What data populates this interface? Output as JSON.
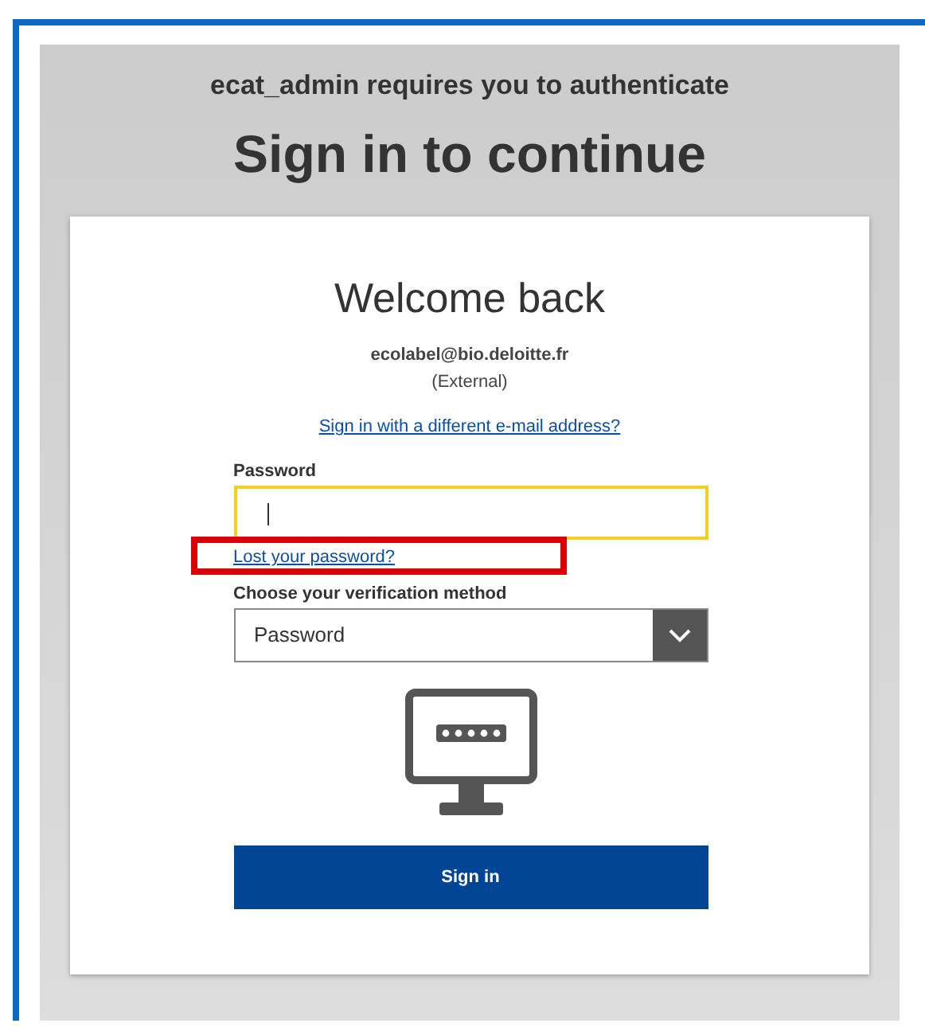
{
  "header": {
    "subtitle": "ecat_admin requires you to authenticate",
    "title": "Sign in to continue"
  },
  "card": {
    "heading": "Welcome back",
    "email": "ecolabel@bio.deloitte.fr",
    "account_type": "(External)",
    "switch_link": "Sign in with a different e-mail address?",
    "password": {
      "label": "Password",
      "focused": true
    },
    "lost_password": {
      "text": "Lost your password?",
      "highlighted": true
    },
    "method": {
      "label": "Choose your verification method",
      "value": "Password"
    },
    "submit": "Sign in"
  }
}
